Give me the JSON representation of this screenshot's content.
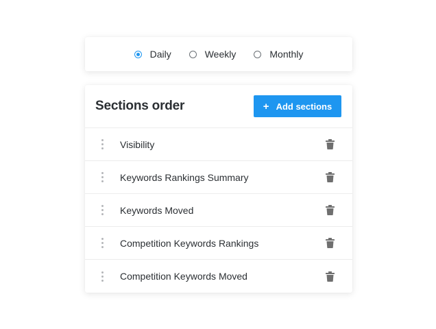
{
  "frequency": {
    "options": [
      {
        "label": "Daily",
        "checked": true
      },
      {
        "label": "Weekly",
        "checked": false
      },
      {
        "label": "Monthly",
        "checked": false
      }
    ]
  },
  "sections": {
    "title": "Sections order",
    "add_button_label": "Add sections",
    "add_button_icon": "+",
    "items": [
      {
        "label": "Visibility"
      },
      {
        "label": "Keywords Rankings Summary"
      },
      {
        "label": "Keywords Moved"
      },
      {
        "label": "Competition Keywords Rankings"
      },
      {
        "label": "Competition Keywords Moved"
      }
    ]
  },
  "colors": {
    "accent": "#1e96f0",
    "text": "#2b2f33",
    "icon": "#6f6f6f"
  }
}
